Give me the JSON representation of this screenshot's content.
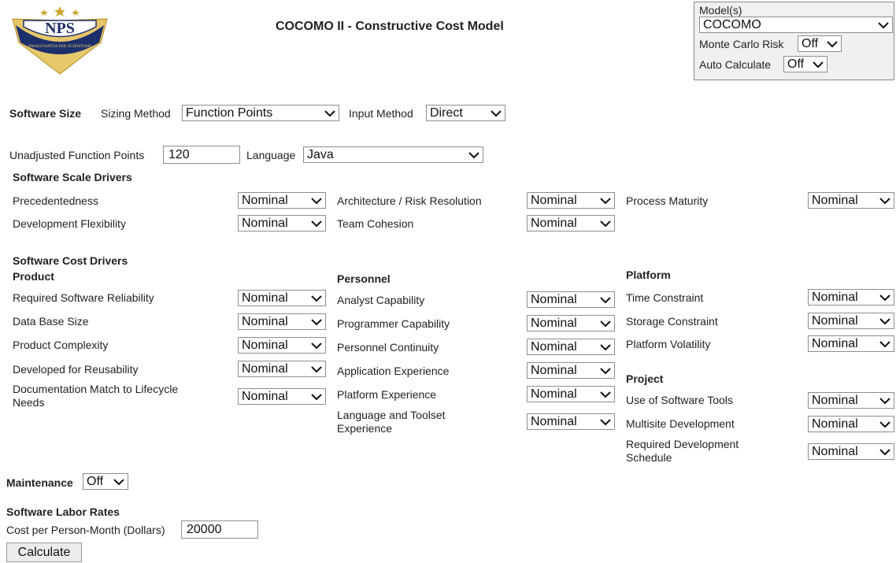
{
  "header": {
    "title": "COCOMO II - Constructive Cost Model",
    "logo_text": "NPS",
    "logo_motto": "PRAESTANTIA PER SCIENTIAM"
  },
  "model_panel": {
    "models_label": "Model(s)",
    "models_value": "COCOMO",
    "monte_carlo_label": "Monte Carlo Risk",
    "monte_carlo_value": "Off",
    "auto_calc_label": "Auto Calculate",
    "auto_calc_value": "Off"
  },
  "size": {
    "heading": "Software Size",
    "sizing_method_label": "Sizing Method",
    "sizing_method_value": "Function Points",
    "input_method_label": "Input Method",
    "input_method_value": "Direct",
    "ufp_label": "Unadjusted Function Points",
    "ufp_value": "120",
    "language_label": "Language",
    "language_value": "Java"
  },
  "scale": {
    "heading": "Software Scale Drivers",
    "precedentedness": {
      "label": "Precedentedness",
      "value": "Nominal"
    },
    "dev_flexibility": {
      "label": "Development Flexibility",
      "value": "Nominal"
    },
    "arch_risk": {
      "label": "Architecture / Risk Resolution",
      "value": "Nominal"
    },
    "team_cohesion": {
      "label": "Team Cohesion",
      "value": "Nominal"
    },
    "process_maturity": {
      "label": "Process Maturity",
      "value": "Nominal"
    }
  },
  "cost": {
    "heading": "Software Cost Drivers",
    "product_heading": "Product",
    "personnel_heading": "Personnel",
    "platform_heading": "Platform",
    "project_heading": "Project",
    "rely": {
      "label": "Required Software Reliability",
      "value": "Nominal"
    },
    "data": {
      "label": "Data Base Size",
      "value": "Nominal"
    },
    "cplx": {
      "label": "Product Complexity",
      "value": "Nominal"
    },
    "ruse": {
      "label": "Developed for Reusability",
      "value": "Nominal"
    },
    "docu": {
      "label": "Documentation Match to Lifecycle Needs",
      "value": "Nominal"
    },
    "acap": {
      "label": "Analyst Capability",
      "value": "Nominal"
    },
    "pcap": {
      "label": "Programmer Capability",
      "value": "Nominal"
    },
    "pcon": {
      "label": "Personnel Continuity",
      "value": "Nominal"
    },
    "apex": {
      "label": "Application Experience",
      "value": "Nominal"
    },
    "plex": {
      "label": "Platform Experience",
      "value": "Nominal"
    },
    "ltex": {
      "label": "Language and Toolset Experience",
      "value": "Nominal"
    },
    "time": {
      "label": "Time Constraint",
      "value": "Nominal"
    },
    "stor": {
      "label": "Storage Constraint",
      "value": "Nominal"
    },
    "pvol": {
      "label": "Platform Volatility",
      "value": "Nominal"
    },
    "tool": {
      "label": "Use of Software Tools",
      "value": "Nominal"
    },
    "site": {
      "label": "Multisite Development",
      "value": "Nominal"
    },
    "sced": {
      "label": "Required Development Schedule",
      "value": "Nominal"
    }
  },
  "maintenance": {
    "label": "Maintenance",
    "value": "Off"
  },
  "labor": {
    "heading": "Software Labor Rates",
    "cost_label": "Cost per Person-Month (Dollars)",
    "cost_value": "20000"
  },
  "actions": {
    "calculate_label": "Calculate"
  },
  "colors": {
    "logo_navy": "#1c2f6b",
    "logo_gold": "#c9a227"
  }
}
